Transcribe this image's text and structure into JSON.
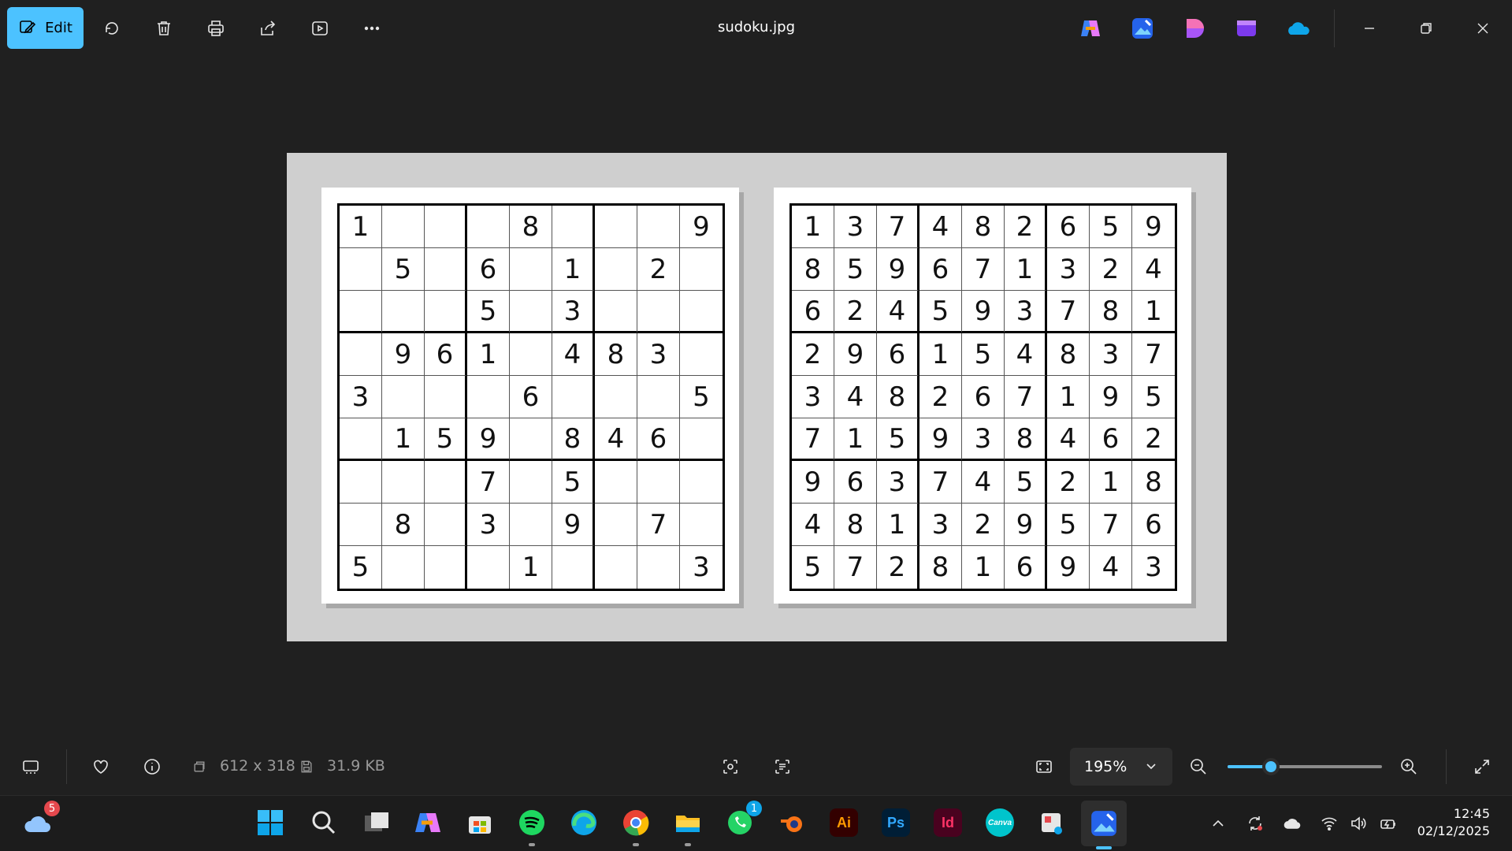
{
  "window": {
    "title": "sudoku.jpg",
    "edit_label": "Edit",
    "accent_color": "#4cc2ff"
  },
  "toolbar": {
    "icons": [
      "edit-icon",
      "rotate-icon",
      "delete-icon",
      "print-icon",
      "share-icon",
      "slideshow-icon",
      "more-icon"
    ],
    "app_icons": [
      "copilot-icon",
      "photos-icon",
      "designer-icon",
      "clipchamp-icon",
      "onedrive-icon"
    ]
  },
  "puzzle": {
    "cells": [
      [
        "1",
        "",
        "",
        "",
        "8",
        "",
        "",
        "",
        "9"
      ],
      [
        "",
        "5",
        "",
        "6",
        "",
        "1",
        "",
        "2",
        ""
      ],
      [
        "",
        "",
        "",
        "5",
        "",
        "3",
        "",
        "",
        ""
      ],
      [
        "",
        "9",
        "6",
        "1",
        "",
        "4",
        "8",
        "3",
        ""
      ],
      [
        "3",
        "",
        "",
        "",
        "6",
        "",
        "",
        "",
        "5"
      ],
      [
        "",
        "1",
        "5",
        "9",
        "",
        "8",
        "4",
        "6",
        ""
      ],
      [
        "",
        "",
        "",
        "7",
        "",
        "5",
        "",
        "",
        ""
      ],
      [
        "",
        "8",
        "",
        "3",
        "",
        "9",
        "",
        "7",
        ""
      ],
      [
        "5",
        "",
        "",
        "",
        "1",
        "",
        "",
        "",
        "3"
      ]
    ]
  },
  "solution": {
    "cells": [
      [
        "1",
        "3",
        "7",
        "4",
        "8",
        "2",
        "6",
        "5",
        "9"
      ],
      [
        "8",
        "5",
        "9",
        "6",
        "7",
        "1",
        "3",
        "2",
        "4"
      ],
      [
        "6",
        "2",
        "4",
        "5",
        "9",
        "3",
        "7",
        "8",
        "1"
      ],
      [
        "2",
        "9",
        "6",
        "1",
        "5",
        "4",
        "8",
        "3",
        "7"
      ],
      [
        "3",
        "4",
        "8",
        "2",
        "6",
        "7",
        "1",
        "9",
        "5"
      ],
      [
        "7",
        "1",
        "5",
        "9",
        "3",
        "8",
        "4",
        "6",
        "2"
      ],
      [
        "9",
        "6",
        "3",
        "7",
        "4",
        "5",
        "2",
        "1",
        "8"
      ],
      [
        "4",
        "8",
        "1",
        "3",
        "2",
        "9",
        "5",
        "7",
        "6"
      ],
      [
        "5",
        "7",
        "2",
        "8",
        "1",
        "6",
        "9",
        "4",
        "3"
      ]
    ]
  },
  "statusbar": {
    "dimensions": "612 x 318",
    "file_size": "31.9 KB",
    "zoom_value": "195%",
    "zoom_slider_fraction": 0.28
  },
  "taskbar": {
    "weather_badge": "5",
    "whatsapp_badge": "1",
    "apps": [
      "start",
      "search",
      "task-view",
      "copilot",
      "microsoft-store",
      "spotify",
      "edge",
      "chrome",
      "file-explorer",
      "whatsapp",
      "blender",
      "illustrator",
      "photoshop",
      "indesign",
      "canva",
      "snipping-tool",
      "photos"
    ],
    "illustrator_label": "Ai",
    "photoshop_label": "Ps",
    "indesign_label": "Id",
    "canva_label": "Canva",
    "time": "12:45",
    "date": "02/12/2025"
  }
}
